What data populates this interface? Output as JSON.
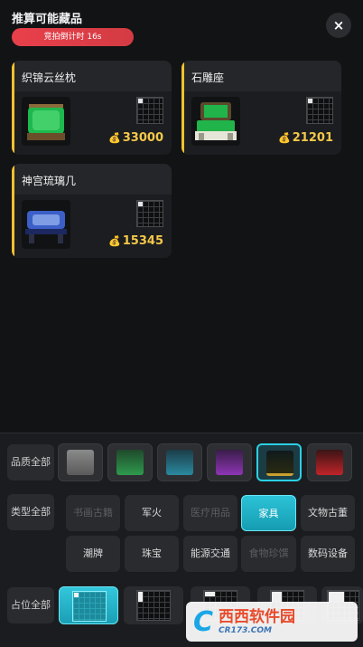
{
  "header": {
    "title": "推算可能藏品",
    "countdown": "竞拍倒计时 16s",
    "close_glyph": "×"
  },
  "items": [
    {
      "name": "织锦云丝枕",
      "price": "33000",
      "coin": "💰",
      "art_color": "#1db84e"
    },
    {
      "name": "石雕座",
      "price": "21201",
      "coin": "💰",
      "art_color": "#21b44a"
    },
    {
      "name": "神宫琉璃几",
      "price": "15345",
      "coin": "💰",
      "art_color": "#3c5fc7"
    }
  ],
  "filters": {
    "quality_label": "品质全部",
    "quality_swatches": [
      {
        "color": "#9a9a9a",
        "selected": false
      },
      {
        "color": "#2e9a4d",
        "selected": false
      },
      {
        "color": "#2a8aa0",
        "selected": false
      },
      {
        "color": "#8e35b5",
        "selected": false
      },
      {
        "color": "#c9a030",
        "selected": true
      },
      {
        "color": "#c02428",
        "selected": false
      }
    ],
    "type_label": "类型全部",
    "type_chips": [
      "书画古籍",
      "军火",
      "医疗用品",
      "家具",
      "文物古董",
      "潮牌",
      "珠宝",
      "能源交通",
      "食物珍馔",
      "数码设备"
    ],
    "occupancy_label": "占位全部"
  },
  "watermark": {
    "logo": "C",
    "main": "西西软件园",
    "sub": "CR173.COM"
  }
}
